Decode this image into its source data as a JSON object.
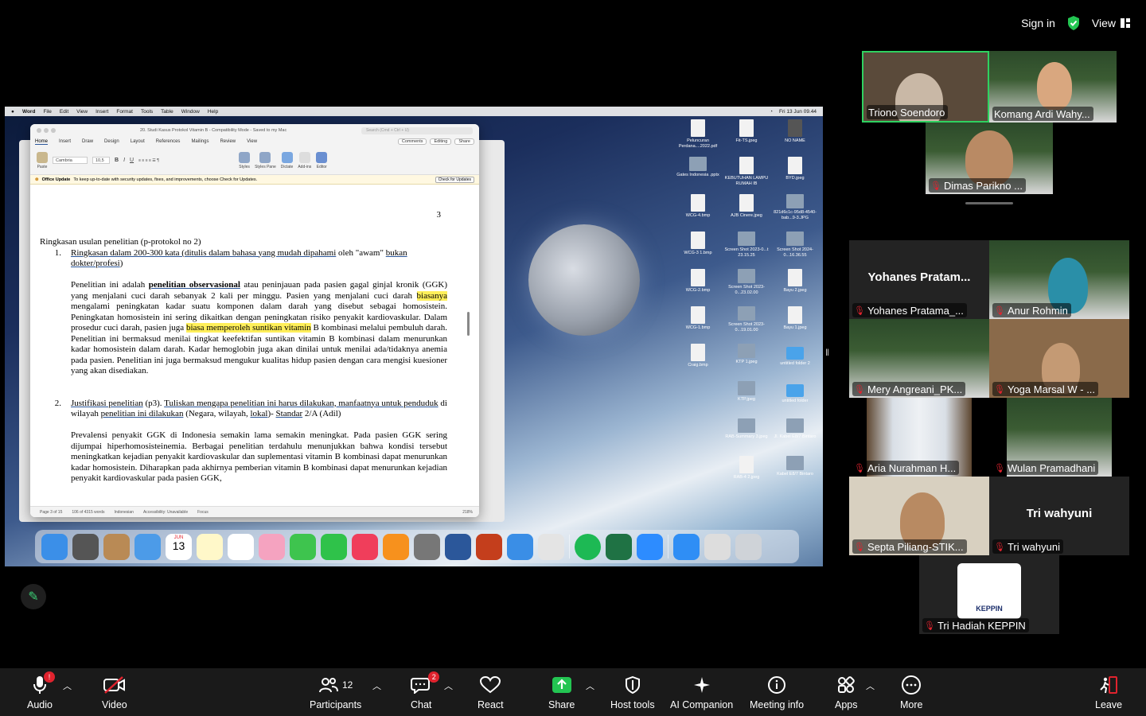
{
  "topbar": {
    "sign_in": "Sign in",
    "view": "View"
  },
  "mac_menu": {
    "apple": "",
    "items": [
      "Word",
      "File",
      "Edit",
      "View",
      "Insert",
      "Format",
      "Tools",
      "Table",
      "Window",
      "Help"
    ],
    "clock": "Fri 13 Jun  09.44"
  },
  "word": {
    "title": "20. Studi Kasus Protokol Vitamin B  -  Compatibility Mode  -  Saved to my Mac",
    "search_placeholder": "Search (Cmd + Ctrl + U)",
    "tabs": [
      "Home",
      "Insert",
      "Draw",
      "Design",
      "Layout",
      "References",
      "Mailings",
      "Review",
      "View"
    ],
    "comments": "Comments",
    "editing": "Editing",
    "share": "Share",
    "font": "Cambria",
    "font_size": "10,5",
    "ribbon_groups": [
      "Paste",
      "Styles",
      "Styles Pane",
      "Dictate",
      "Add-ins",
      "Editor"
    ],
    "update_title": "Office Update",
    "update_text": "To keep up-to-date with security updates, fixes, and improvements, choose Check for Updates.",
    "update_button": "Check for Updates",
    "page_number": "3",
    "heading": "Ringkasan usulan penelitian (p-protokol no 2)",
    "item1_num": "1.",
    "item1_a": "Ringkasan dalam 200-300 kata  (",
    "item1_b": "ditulis dalam bahasa yang mudah dipahami",
    "item1_c": " oleh \"awam\" ",
    "item1_d": "bukan dokter/profesi",
    "item1_e": ")",
    "p1_a": "Penelitian ini adalah ",
    "p1_b": "penelitian observasional",
    "p1_c": " atau peninjauan pada pasien gagal ginjal kronik (GGK) yang menjalani cuci darah sebanyak 2 kali per minggu. Pasien yang menjalani cuci darah ",
    "p1_d": "biasanya",
    "p1_e": " mengalami peningkatan kadar suatu komponen dalam darah yang disebut sebagai homosistein. Peningkatan homosistein ini sering dikaitkan dengan peningkatan risiko penyakit kardiovaskular. Dalam prosedur cuci darah, pasien juga ",
    "p1_f": "biasa memperoleh suntikan vitamin",
    "p1_g": " B kombinasi melalui pembuluh darah. Penelitian ini bermaksud menilai tingkat keefektifan suntikan vitamin B kombinasi dalam menurunkan kadar homosistein dalam darah. Kadar hemoglobin juga akan dinilai untuk menilai ada/tidaknya anemia pada pasien. Penelitian ini juga bermaksud mengukur kualitas hidup pasien dengan cara mengisi kuesioner yang akan disediakan.",
    "item2_num": "2.",
    "item2_a": "Justifikasi penelitian",
    "item2_b": " (p3). ",
    "item2_c": "Tuliskan mengapa penelitian ini harus dilakukan, manfaatnya untuk penduduk",
    "item2_d": " di wilayah ",
    "item2_e": "penelitian ini dilakukan",
    "item2_f": " (Negara, wilayah, ",
    "item2_g": "lokal",
    "item2_h": ")- ",
    "item2_i": "Standar",
    "item2_j": " 2/A (Adil)",
    "p2": "Prevalensi penyakit GGK di Indonesia semakin lama semakin meningkat. Pada pasien GGK sering dijumpai hiperhomosisteinemia. Berbagai penelitian terdahulu menunjukkan bahwa kondisi tersebut meningkatkan kejadian penyakit kardiovaskular dan suplementasi vitamin B kombinasi dapat menurunkan kadar homosistein. Diharapkan pada akhirnya pemberian vitamin B kombinasi dapat menurunkan kejadian penyakit kardiovaskular pada pasien GGK,",
    "status_page": "Page 3 of 15",
    "status_words": "106 of 4315 words",
    "status_lang": "Indonesian",
    "status_access": "Accessibility: Unavailable",
    "status_focus": "Focus",
    "status_zoom": "218%"
  },
  "desktop_icons": [
    {
      "label": "Peluncuran Perdana....2022.pdf",
      "kind": "doc"
    },
    {
      "label": "Fit-TS.jpeg",
      "kind": "doc"
    },
    {
      "label": "NO NAME",
      "kind": "dark"
    },
    {
      "label": "Gates Indonesia .pptx",
      "kind": "img"
    },
    {
      "label": "KEBUTUHAN LAMPU RUMAH IB",
      "kind": "doc"
    },
    {
      "label": "BYD.jpeg",
      "kind": "doc"
    },
    {
      "label": "WCG-4.bmp",
      "kind": "doc"
    },
    {
      "label": "AJB Cinere.jpeg",
      "kind": "doc"
    },
    {
      "label": "821d6c1c-95d8-4540-bab...9-3.JPG",
      "kind": "img"
    },
    {
      "label": "WCG-3 1.bmp",
      "kind": "doc"
    },
    {
      "label": "Screen Shot 2023-0...t 23.15.25",
      "kind": "img"
    },
    {
      "label": "Screen Shot 2024-0...16.36.55",
      "kind": "img"
    },
    {
      "label": "WCG-2.bmp",
      "kind": "doc"
    },
    {
      "label": "Screen Shot 2023-0...23.02.00",
      "kind": "img"
    },
    {
      "label": "Bayu 2.jpeg",
      "kind": "doc"
    },
    {
      "label": "WCG-1.bmp",
      "kind": "doc"
    },
    {
      "label": "Screen Shot 2023-0...19.01.00",
      "kind": "img"
    },
    {
      "label": "Bayu 1.jpeg",
      "kind": "doc"
    },
    {
      "label": "Craig.bmp",
      "kind": "doc"
    },
    {
      "label": "KTP 1.jpeg",
      "kind": "img"
    },
    {
      "label": "untitled folder 2",
      "kind": "folder"
    },
    {
      "label": "",
      "kind": "none"
    },
    {
      "label": "KTP.jpeg",
      "kind": "img"
    },
    {
      "label": "untitled folder",
      "kind": "folder"
    },
    {
      "label": "",
      "kind": "none"
    },
    {
      "label": "RAB-Summary 3.jpeg",
      "kind": "img"
    },
    {
      "label": "Jl. Kabel E8/7 Bintaro",
      "kind": "img"
    },
    {
      "label": "",
      "kind": "none"
    },
    {
      "label": "RAB-4 2.jpeg",
      "kind": "doc"
    },
    {
      "label": "Kabel E8/7 Bintaro",
      "kind": "img"
    }
  ],
  "dock_calendar": {
    "month": "JUN",
    "day": "13"
  },
  "participants": {
    "speaker": [
      {
        "name": "Triono Soendoro",
        "muted": false,
        "active": true
      },
      {
        "name": "Komang Ardi Wahy...",
        "muted": false,
        "active": false
      },
      {
        "name": "Dimas Parikno ...",
        "muted": true,
        "active": false
      }
    ],
    "gallery": [
      {
        "name": "Yohanes Pratama_...",
        "big_name": "Yohanes  Pratam...",
        "muted": true
      },
      {
        "name": "Anur Rohmin",
        "big_name": "",
        "muted": true
      },
      {
        "name": "Mery Angreani_PK...",
        "big_name": "",
        "muted": true
      },
      {
        "name": "Yoga Marsal W - ...",
        "big_name": "",
        "muted": true
      },
      {
        "name": "Aria Nurahman H...",
        "big_name": "",
        "muted": true
      },
      {
        "name": "Wulan Pramadhani",
        "big_name": "",
        "muted": true
      },
      {
        "name": "Septa Piliang-STIK...",
        "big_name": "",
        "muted": true
      },
      {
        "name": "Tri wahyuni",
        "big_name": "Tri wahyuni",
        "muted": true
      },
      {
        "name": "Tri Hadiah KEPPIN",
        "big_name": "",
        "muted": true
      }
    ],
    "logo_text": "KEPPIN"
  },
  "toolbar": {
    "audio": "Audio",
    "audio_badge": "!",
    "video": "Video",
    "participants": "Participants",
    "participants_count": "12",
    "chat": "Chat",
    "chat_badge": "2",
    "react": "React",
    "share": "Share",
    "host_tools": "Host tools",
    "ai_companion": "AI Companion",
    "meeting_info": "Meeting info",
    "apps": "Apps",
    "more": "More",
    "leave": "Leave"
  },
  "colors": {
    "accent_green": "#2fd160",
    "toolbar_bg": "#1a1a1a",
    "muted_red": "#e0232e",
    "share_green": "#23c552"
  }
}
